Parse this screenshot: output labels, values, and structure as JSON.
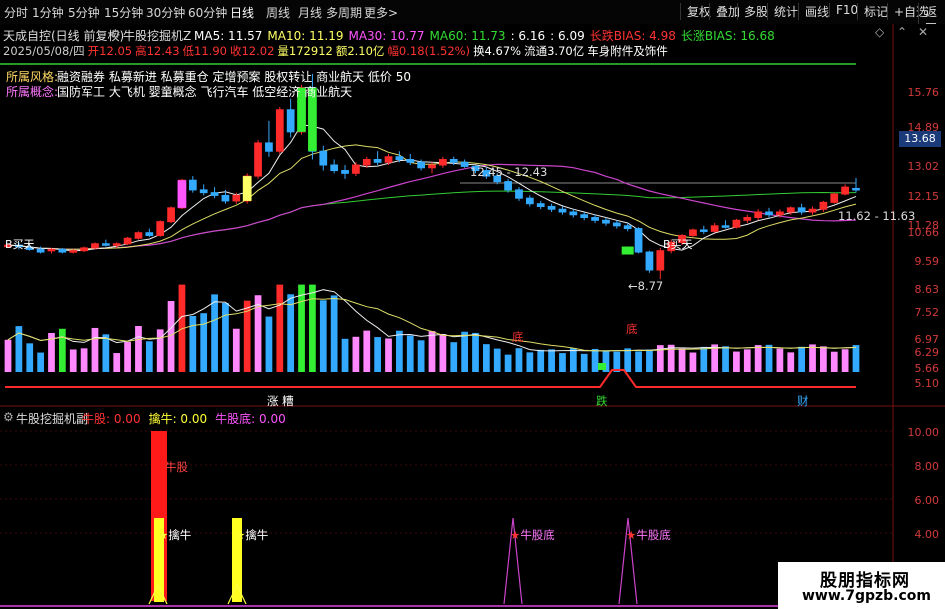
{
  "toolbar": {
    "left_items": [
      "分时",
      "1分钟",
      "5分钟",
      "15分钟",
      "30分钟",
      "60分钟",
      "日线",
      "周线",
      "月线",
      "多周期",
      "更多>"
    ],
    "active": "日线",
    "right_items": [
      "复权",
      "叠加",
      "多股",
      "统计",
      "画线",
      "F10",
      "标记",
      "+自选",
      "返回"
    ]
  },
  "header": {
    "stock": "天成自控(日线 前复权)",
    "indicator": "牛股挖掘机Z",
    "ma": [
      {
        "label": "MA5: 11.57",
        "color": "#ffffff"
      },
      {
        "label": "MA10: 11.19",
        "color": "#ffff66"
      },
      {
        "label": "MA30: 10.77",
        "color": "#ff55ff"
      },
      {
        "label": "MA60: 11.73",
        "color": "#33dd33"
      },
      {
        "label": ": 6.16",
        "color": "#ffffff"
      },
      {
        "label": ": 6.09",
        "color": "#ffffff"
      },
      {
        "label": "长跌BIAS: 4.98",
        "color": "#ff3333"
      },
      {
        "label": "长涨BIAS: 16.68",
        "color": "#33dd33"
      }
    ],
    "date_line": [
      {
        "t": "2025/05/08/四",
        "c": "#cccccc"
      },
      {
        "t": "开12.05",
        "c": "#ff3333"
      },
      {
        "t": "高12.43",
        "c": "#ff3333"
      },
      {
        "t": "低11.90",
        "c": "#ff3333"
      },
      {
        "t": "收12.02",
        "c": "#ff3333"
      },
      {
        "t": "量172912",
        "c": "#ffff66"
      },
      {
        "t": "额2.10亿",
        "c": "#ffff66"
      },
      {
        "t": "幅0.18(1.52%)",
        "c": "#ff3333"
      },
      {
        "t": "换4.67%",
        "c": "#ffffff"
      },
      {
        "t": "流通3.70亿",
        "c": "#ffffff"
      },
      {
        "t": "车身附件及饰件",
        "c": "#ffffff"
      }
    ],
    "style_label": "所属风格:",
    "style_value": "融资融券 私募新进 私募重仓 定增预案 股权转让 商业航天 低价 50",
    "concept_label": "所属概念:",
    "concept_value": "国防军工 大飞机 婴童概念 飞行汽车 低空经济 商业航天"
  },
  "price_axis": [
    "15.76",
    "14.89",
    "13.68",
    "13.02",
    "12.15",
    "11.28",
    "10.66",
    "9.59",
    "8.63"
  ],
  "price_current": "13.68",
  "vol_axis": [
    "7.52",
    "6.97",
    "6.29",
    "5.66",
    "5.10"
  ],
  "sub_axis": [
    "10.00",
    "8.00",
    "6.00",
    "4.00"
  ],
  "annotations": {
    "high1": "12.45 - 12.43",
    "high2": "11.62 - 11.63",
    "low": "8.77",
    "buy1": "B买天",
    "buy2": "B买天",
    "di1": "底",
    "di2": "底",
    "zhangting": "涨 糟",
    "die": "跌",
    "cai": "财"
  },
  "sub": {
    "title": "牛股挖掘机副",
    "items": [
      {
        "label": "牛股: 0.00",
        "color": "#ff3333"
      },
      {
        "label": "擒牛: 0.00",
        "color": "#ffff33"
      },
      {
        "label": "牛股底: 0.00",
        "color": "#ff55ff"
      }
    ],
    "niugu": "牛股",
    "qinniu1": "擒牛",
    "qinniu2": "擒牛",
    "niugudi1": "牛股底",
    "niugudi2": "牛股底"
  },
  "watermark": {
    "line1": "股朋指标网",
    "line2": "www.7gpzb.com"
  },
  "chart_data": {
    "type": "candlestick",
    "candles": [
      [
        9.95,
        10.05,
        9.9,
        10.0
      ],
      [
        10.0,
        10.1,
        9.85,
        9.95
      ],
      [
        9.9,
        10.0,
        9.8,
        9.85
      ],
      [
        9.85,
        9.95,
        9.7,
        9.75
      ],
      [
        9.8,
        9.9,
        9.7,
        9.85
      ],
      [
        9.85,
        9.9,
        9.7,
        9.75
      ],
      [
        9.75,
        9.85,
        9.7,
        9.8
      ],
      [
        9.8,
        9.95,
        9.75,
        9.9
      ],
      [
        9.9,
        10.1,
        9.85,
        10.05
      ],
      [
        10.05,
        10.2,
        9.95,
        10.0
      ],
      [
        10.0,
        10.1,
        9.9,
        10.05
      ],
      [
        10.05,
        10.3,
        10.0,
        10.25
      ],
      [
        10.25,
        10.5,
        10.2,
        10.45
      ],
      [
        10.45,
        10.6,
        10.3,
        10.35
      ],
      [
        10.35,
        10.9,
        10.3,
        10.85
      ],
      [
        10.85,
        11.4,
        10.8,
        11.35
      ],
      [
        11.35,
        12.4,
        11.3,
        12.35
      ],
      [
        12.35,
        12.5,
        11.9,
        12.0
      ],
      [
        12.0,
        12.2,
        11.8,
        11.9
      ],
      [
        11.9,
        12.1,
        11.7,
        11.8
      ],
      [
        11.8,
        12.0,
        11.5,
        11.6
      ],
      [
        11.6,
        11.9,
        11.5,
        11.8
      ],
      [
        11.6,
        12.6,
        11.5,
        12.5
      ],
      [
        12.5,
        13.8,
        12.4,
        13.7
      ],
      [
        13.7,
        14.5,
        13.2,
        13.4
      ],
      [
        13.4,
        15.0,
        13.3,
        14.9
      ],
      [
        14.9,
        15.3,
        13.9,
        14.1
      ],
      [
        14.1,
        15.8,
        14.0,
        15.7
      ],
      [
        15.7,
        16.2,
        13.1,
        13.4
      ],
      [
        13.4,
        13.6,
        12.7,
        12.9
      ],
      [
        12.9,
        13.1,
        12.6,
        12.7
      ],
      [
        12.7,
        12.9,
        12.4,
        12.6
      ],
      [
        12.6,
        13.0,
        12.5,
        12.9
      ],
      [
        12.9,
        13.2,
        12.8,
        13.1
      ],
      [
        13.1,
        13.4,
        12.9,
        13.0
      ],
      [
        13.0,
        13.3,
        12.9,
        13.2
      ],
      [
        13.2,
        13.4,
        13.0,
        13.1
      ],
      [
        13.1,
        13.3,
        12.9,
        13.0
      ],
      [
        13.0,
        13.1,
        12.7,
        12.8
      ],
      [
        12.8,
        13.0,
        12.6,
        12.9
      ],
      [
        12.9,
        13.2,
        12.8,
        13.1
      ],
      [
        13.1,
        13.2,
        12.9,
        13.0
      ],
      [
        13.0,
        13.1,
        12.8,
        12.85
      ],
      [
        12.85,
        12.9,
        12.6,
        12.7
      ],
      [
        12.7,
        12.8,
        12.4,
        12.5
      ],
      [
        12.5,
        12.6,
        12.2,
        12.3
      ],
      [
        12.3,
        12.4,
        11.9,
        12.0
      ],
      [
        12.0,
        12.1,
        11.6,
        11.7
      ],
      [
        11.7,
        11.8,
        11.4,
        11.5
      ],
      [
        11.5,
        11.6,
        11.3,
        11.4
      ],
      [
        11.4,
        11.5,
        11.2,
        11.3
      ],
      [
        11.3,
        11.4,
        11.1,
        11.2
      ],
      [
        11.2,
        11.3,
        11.0,
        11.1
      ],
      [
        11.1,
        11.2,
        10.9,
        11.0
      ],
      [
        11.0,
        11.1,
        10.8,
        10.9
      ],
      [
        10.9,
        11.0,
        10.7,
        10.8
      ],
      [
        10.8,
        10.9,
        10.6,
        10.7
      ],
      [
        10.7,
        10.8,
        10.5,
        10.6
      ],
      [
        10.6,
        10.65,
        9.7,
        9.75
      ],
      [
        9.75,
        9.8,
        9.0,
        9.1
      ],
      [
        9.1,
        9.9,
        8.77,
        9.8
      ],
      [
        9.8,
        10.2,
        9.7,
        10.1
      ],
      [
        10.1,
        10.4,
        10.0,
        10.35
      ],
      [
        10.35,
        10.6,
        10.3,
        10.55
      ],
      [
        10.55,
        10.7,
        10.4,
        10.5
      ],
      [
        10.5,
        10.8,
        10.45,
        10.7
      ],
      [
        10.7,
        10.9,
        10.6,
        10.65
      ],
      [
        10.65,
        10.95,
        10.6,
        10.9
      ],
      [
        10.9,
        11.1,
        10.8,
        11.0
      ],
      [
        11.0,
        11.3,
        10.9,
        11.2
      ],
      [
        11.2,
        11.35,
        11.0,
        11.1
      ],
      [
        11.1,
        11.3,
        11.0,
        11.2
      ],
      [
        11.2,
        11.4,
        11.1,
        11.35
      ],
      [
        11.35,
        11.5,
        11.1,
        11.2
      ],
      [
        11.2,
        11.4,
        11.1,
        11.3
      ],
      [
        11.3,
        11.6,
        11.2,
        11.55
      ],
      [
        11.55,
        11.9,
        11.5,
        11.85
      ],
      [
        11.85,
        12.2,
        11.8,
        12.1
      ],
      [
        12.05,
        12.43,
        11.9,
        12.02
      ]
    ],
    "volume_note": "volume bars colored red/blue/green/pink by rule"
  }
}
